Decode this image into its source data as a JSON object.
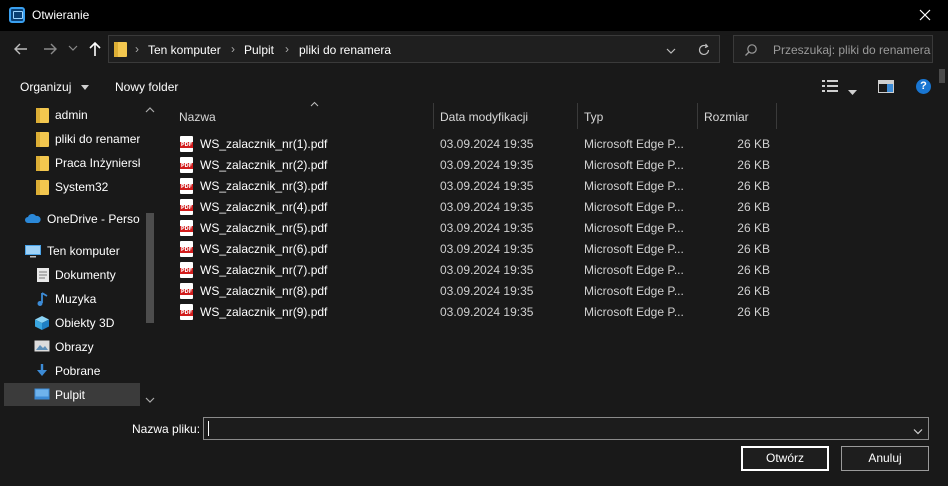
{
  "window": {
    "title": "Otwieranie"
  },
  "address": {
    "crumbs": [
      "Ten komputer",
      "Pulpit",
      "pliki do renamera"
    ]
  },
  "search": {
    "placeholder": "Przeszukaj: pliki do renamera"
  },
  "toolbar": {
    "organize_label": "Organizuj",
    "new_folder_label": "Nowy folder",
    "help_label": "?"
  },
  "sidebar": {
    "items": [
      {
        "label": "admin",
        "icon": "folder-icon"
      },
      {
        "label": "pliki do renamer",
        "icon": "folder-icon"
      },
      {
        "label": "Praca Inżynierska",
        "icon": "folder-icon"
      },
      {
        "label": "System32",
        "icon": "folder-icon"
      },
      {
        "label": "OneDrive - Personal",
        "icon": "cloud-icon"
      },
      {
        "label": "Ten komputer",
        "icon": "computer-icon"
      },
      {
        "label": "Dokumenty",
        "icon": "documents-icon"
      },
      {
        "label": "Muzyka",
        "icon": "music-icon"
      },
      {
        "label": "Obiekty 3D",
        "icon": "cube-icon"
      },
      {
        "label": "Obrazy",
        "icon": "pictures-icon"
      },
      {
        "label": "Pobrane",
        "icon": "download-icon"
      },
      {
        "label": "Pulpit",
        "icon": "desktop-icon"
      }
    ]
  },
  "files": {
    "columns": {
      "name": "Nazwa",
      "date": "Data modyfikacji",
      "type": "Typ",
      "size": "Rozmiar"
    },
    "pdf_badge": "PDF",
    "rows": [
      {
        "name": "WS_zalacznik_nr(1).pdf",
        "date": "03.09.2024 19:35",
        "type": "Microsoft Edge P...",
        "size": "26 KB"
      },
      {
        "name": "WS_zalacznik_nr(2).pdf",
        "date": "03.09.2024 19:35",
        "type": "Microsoft Edge P...",
        "size": "26 KB"
      },
      {
        "name": "WS_zalacznik_nr(3).pdf",
        "date": "03.09.2024 19:35",
        "type": "Microsoft Edge P...",
        "size": "26 KB"
      },
      {
        "name": "WS_zalacznik_nr(4).pdf",
        "date": "03.09.2024 19:35",
        "type": "Microsoft Edge P...",
        "size": "26 KB"
      },
      {
        "name": "WS_zalacznik_nr(5).pdf",
        "date": "03.09.2024 19:35",
        "type": "Microsoft Edge P...",
        "size": "26 KB"
      },
      {
        "name": "WS_zalacznik_nr(6).pdf",
        "date": "03.09.2024 19:35",
        "type": "Microsoft Edge P...",
        "size": "26 KB"
      },
      {
        "name": "WS_zalacznik_nr(7).pdf",
        "date": "03.09.2024 19:35",
        "type": "Microsoft Edge P...",
        "size": "26 KB"
      },
      {
        "name": "WS_zalacznik_nr(8).pdf",
        "date": "03.09.2024 19:35",
        "type": "Microsoft Edge P...",
        "size": "26 KB"
      },
      {
        "name": "WS_zalacznik_nr(9).pdf",
        "date": "03.09.2024 19:35",
        "type": "Microsoft Edge P...",
        "size": "26 KB"
      }
    ]
  },
  "footer": {
    "filename_label": "Nazwa pliku:",
    "filename_value": "",
    "open_label": "Otwórz",
    "cancel_label": "Anuluj"
  },
  "colors": {
    "accent": "#1976d2",
    "folder": "#f3c74f",
    "pdf_red": "#d21c1c",
    "background": "#191919"
  }
}
